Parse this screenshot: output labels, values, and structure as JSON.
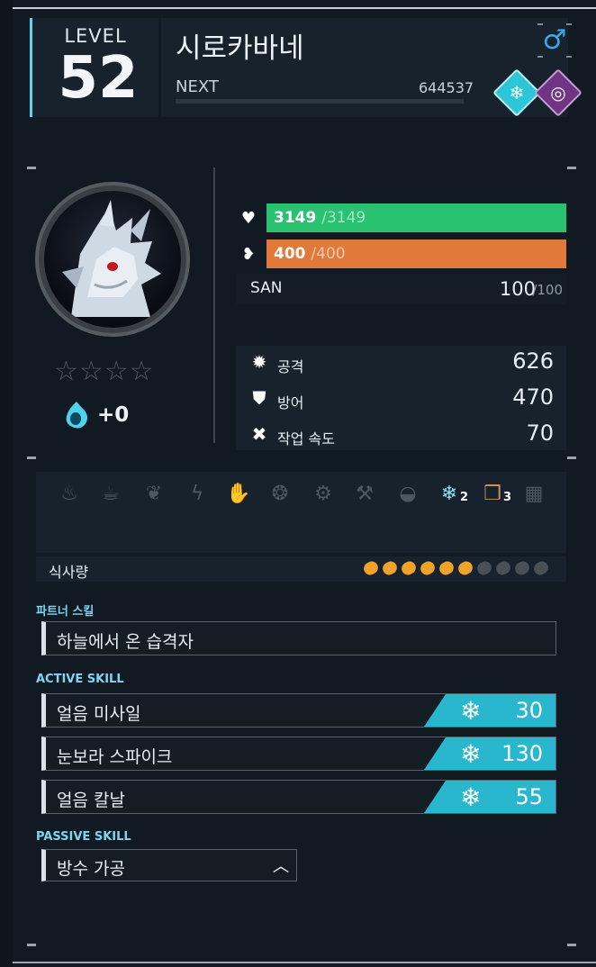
{
  "level": {
    "label": "LEVEL",
    "value": "52"
  },
  "pal": {
    "name": "시로카바네",
    "next_label": "NEXT",
    "next_exp": "644537",
    "gender_icon": "male-icon",
    "elements": [
      {
        "name": "ice",
        "color": "#2cc6d8"
      },
      {
        "name": "dark",
        "color": "#7b3d8f"
      }
    ]
  },
  "souls": "+0",
  "stars": "☆☆☆☆",
  "hp": {
    "current": "3149",
    "max": "/3149",
    "ratio": 1.0,
    "color": "#28c271"
  },
  "sp": {
    "current": "400",
    "max": "/400",
    "ratio": 1.0,
    "color": "#e0793a"
  },
  "san": {
    "label": "SAN",
    "value": "100",
    "max": "/100"
  },
  "stats": [
    {
      "label": "공격",
      "value": "626",
      "icon": "attack-icon"
    },
    {
      "label": "방어",
      "value": "470",
      "icon": "shield-icon"
    },
    {
      "label": "작업 속도",
      "value": "70",
      "icon": "tool-icon"
    }
  ],
  "work": [
    {
      "icon": "kindling-icon",
      "level": ""
    },
    {
      "icon": "watering-icon",
      "level": ""
    },
    {
      "icon": "planting-icon",
      "level": ""
    },
    {
      "icon": "electricity-icon",
      "level": ""
    },
    {
      "icon": "handiwork-icon",
      "level": ""
    },
    {
      "icon": "gathering-icon",
      "level": ""
    },
    {
      "icon": "lumbering-icon",
      "level": ""
    },
    {
      "icon": "mining-icon",
      "level": ""
    },
    {
      "icon": "medicine-icon",
      "level": ""
    },
    {
      "icon": "cooling-icon",
      "level": "2"
    },
    {
      "icon": "transporting-icon",
      "level": "3"
    },
    {
      "icon": "farming-icon",
      "level": ""
    }
  ],
  "food": {
    "label": "식사량",
    "filled": 6,
    "total": 10
  },
  "sections": {
    "partner": "파트너 스킬",
    "active": "ACTIVE SKILL",
    "passive": "PASSIVE SKILL"
  },
  "partner_skill": "하늘에서 온 습격자",
  "active_skills": [
    {
      "name": "얼음 미사일",
      "power": "30"
    },
    {
      "name": "눈보라 스파이크",
      "power": "130"
    },
    {
      "name": "얼음 칼날",
      "power": "55"
    }
  ],
  "passive_skill": "방수 가공"
}
